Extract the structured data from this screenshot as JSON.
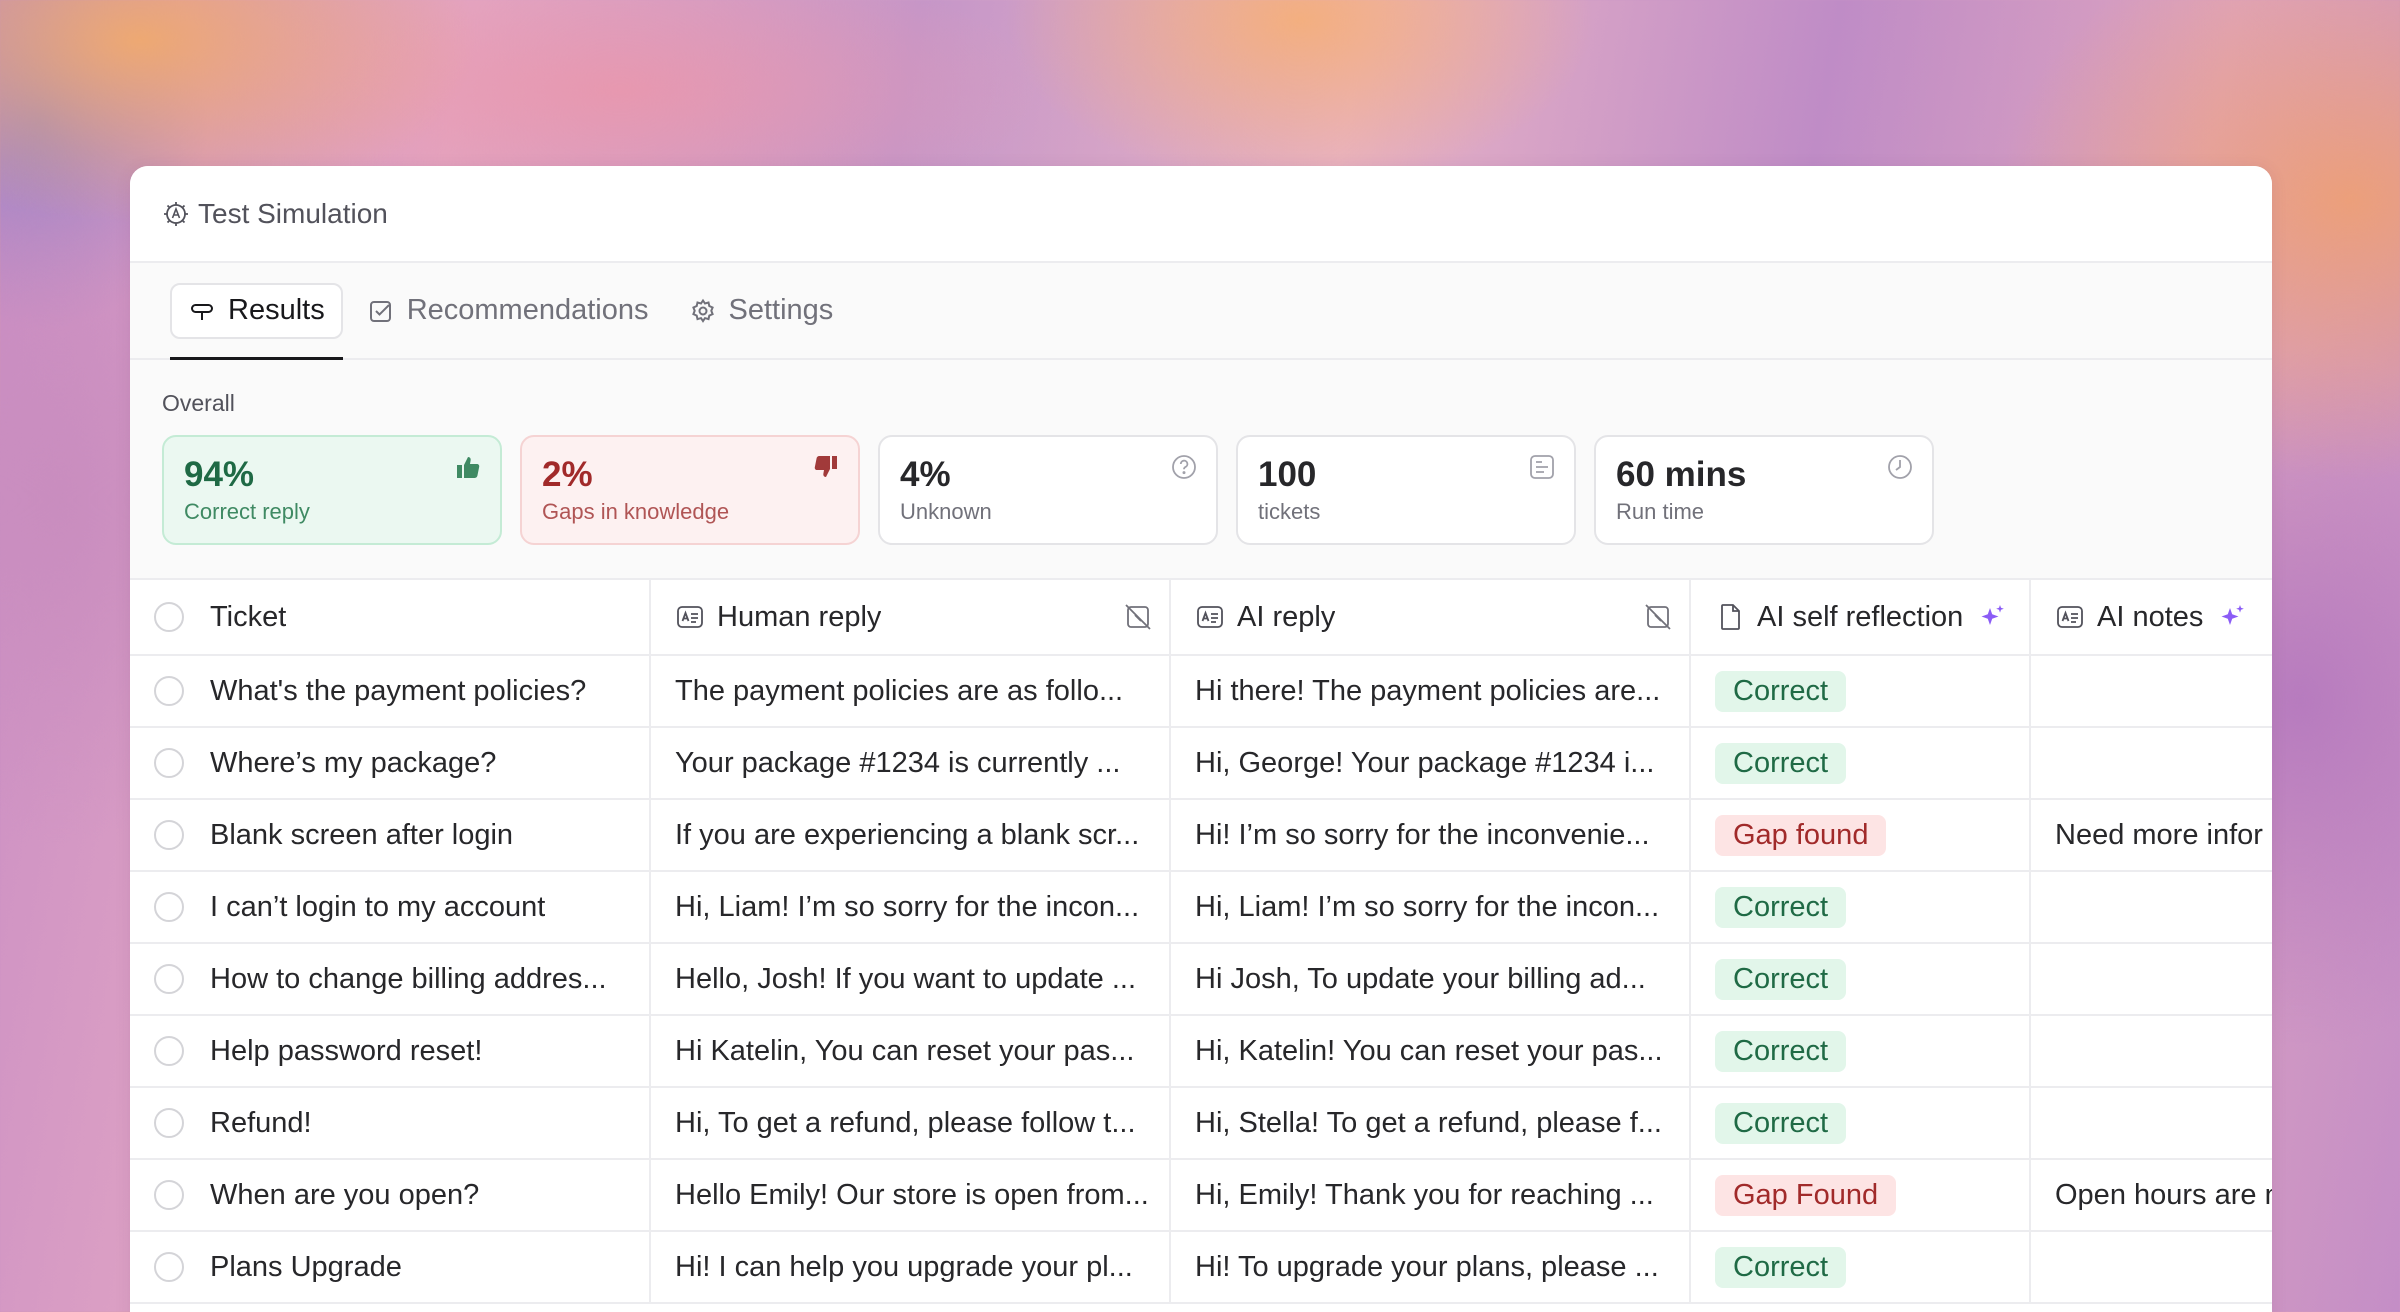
{
  "window": {
    "title": "Test Simulation"
  },
  "tabs": [
    {
      "label": "Results",
      "icon": "results-icon",
      "active": true
    },
    {
      "label": "Recommendations",
      "icon": "recommendations-icon",
      "active": false
    },
    {
      "label": "Settings",
      "icon": "gear-icon",
      "active": false
    }
  ],
  "overall": {
    "label": "Overall",
    "cards": [
      {
        "value": "94%",
        "sub": "Correct reply",
        "icon": "thumbs-up-icon"
      },
      {
        "value": "2%",
        "sub": "Gaps in knowledge",
        "icon": "thumbs-down-icon"
      },
      {
        "value": "4%",
        "sub": "Unknown",
        "icon": "question-icon"
      },
      {
        "value": "100",
        "sub": "tickets",
        "icon": "ticket-icon"
      },
      {
        "value": "60 mins",
        "sub": "Run time",
        "icon": "clock-icon"
      }
    ]
  },
  "table": {
    "headers": {
      "ticket": "Ticket",
      "human": "Human reply",
      "ai": "AI reply",
      "reflection": "AI self reflection",
      "notes": "AI notes"
    },
    "rows": [
      {
        "ticket": "What's the payment policies?",
        "human": "The payment policies are as follo...",
        "ai": "Hi there! The payment policies are...",
        "status": "Correct",
        "notes": ""
      },
      {
        "ticket": "Where’s my package?",
        "human": "Your package #1234 is currently ...",
        "ai": "Hi, George! Your package #1234 i...",
        "status": "Correct",
        "notes": ""
      },
      {
        "ticket": "Blank screen after login",
        "human": "If you are experiencing a blank scr...",
        "ai": "Hi! I’m so sorry for the inconvenie...",
        "status": "Gap found",
        "notes": "Need more infor"
      },
      {
        "ticket": "I can’t login to my account",
        "human": "Hi, Liam! I’m so sorry for the incon...",
        "ai": "Hi, Liam! I’m so sorry for the incon...",
        "status": "Correct",
        "notes": ""
      },
      {
        "ticket": "How to change billing addres...",
        "human": "Hello, Josh! If you want to update ...",
        "ai": "Hi Josh, To update your billing ad...",
        "status": "Correct",
        "notes": ""
      },
      {
        "ticket": "Help password reset!",
        "human": "Hi Katelin, You can reset your pas...",
        "ai": "Hi, Katelin! You can reset your pas...",
        "status": "Correct",
        "notes": ""
      },
      {
        "ticket": "Refund!",
        "human": "Hi, To get a refund, please follow t...",
        "ai": "Hi, Stella! To get a refund, please f...",
        "status": "Correct",
        "notes": ""
      },
      {
        "ticket": "When are you open?",
        "human": "Hello Emily! Our store is open from...",
        "ai": "Hi, Emily! Thank you for reaching ...",
        "status": "Gap Found",
        "notes": "Open hours are n"
      },
      {
        "ticket": "Plans Upgrade",
        "human": "Hi! I can help you upgrade your pl...",
        "ai": "Hi! To upgrade your plans, please ...",
        "status": "Correct",
        "notes": ""
      }
    ]
  },
  "colors": {
    "correct_bg": "#e2f6ea",
    "correct_fg": "#1f6a45",
    "gap_bg": "#fde4e4",
    "gap_fg": "#a12a2a",
    "sparkle": "#8b5cf6"
  }
}
